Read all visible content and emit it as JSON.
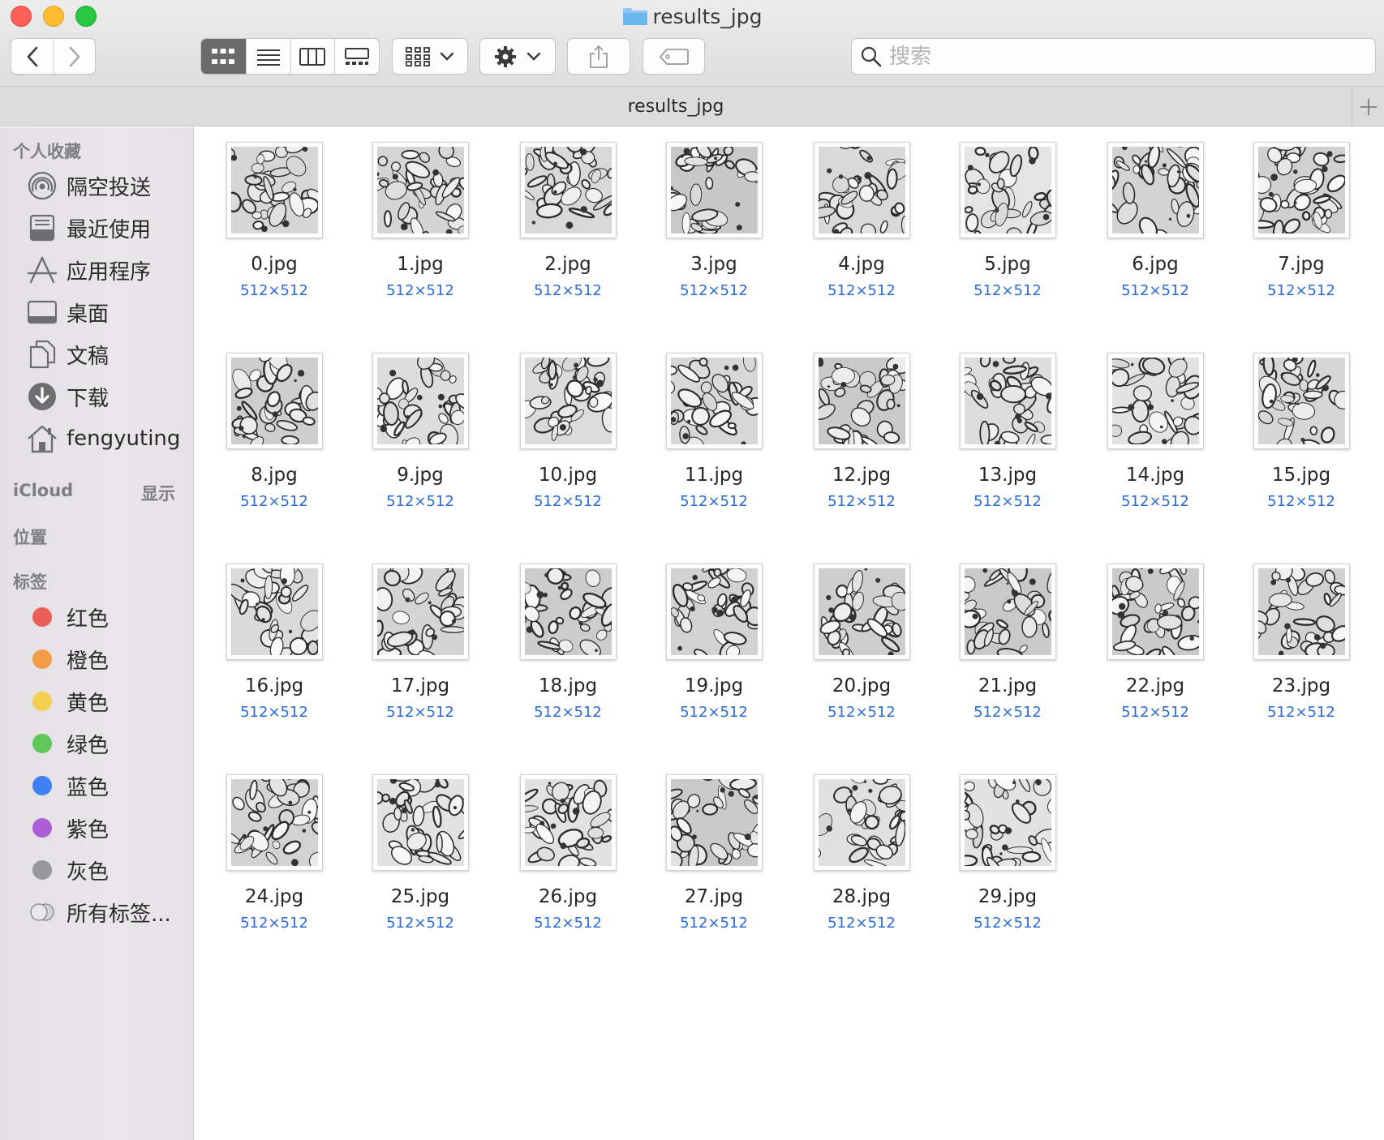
{
  "window": {
    "title": "results_jpg",
    "tab_title": "results_jpg"
  },
  "toolbar": {
    "back": "back",
    "forward": "forward",
    "views": [
      "icon-view",
      "list-view",
      "column-view",
      "gallery-view"
    ],
    "active_view": "icon-view",
    "search_placeholder": "搜索"
  },
  "sidebar": {
    "favorites_heading": "个人收藏",
    "favorites": [
      {
        "label": "隔空投送",
        "icon": "airdrop-icon"
      },
      {
        "label": "最近使用",
        "icon": "recents-icon"
      },
      {
        "label": "应用程序",
        "icon": "applications-icon"
      },
      {
        "label": "桌面",
        "icon": "desktop-icon"
      },
      {
        "label": "文稿",
        "icon": "documents-icon"
      },
      {
        "label": "下载",
        "icon": "downloads-icon"
      },
      {
        "label": "fengyuting",
        "icon": "home-icon"
      }
    ],
    "icloud_heading": "iCloud",
    "icloud_show": "显示",
    "locations_heading": "位置",
    "tags_heading": "标签",
    "tags": [
      {
        "label": "红色",
        "color": "#ec5f59"
      },
      {
        "label": "橙色",
        "color": "#f29c47"
      },
      {
        "label": "黄色",
        "color": "#f5cd4f"
      },
      {
        "label": "绿色",
        "color": "#60c759"
      },
      {
        "label": "蓝色",
        "color": "#3f80f6"
      },
      {
        "label": "紫色",
        "color": "#ac5ed6"
      },
      {
        "label": "灰色",
        "color": "#98979b"
      },
      {
        "label": "所有标签...",
        "color": "all-tags"
      }
    ]
  },
  "files": [
    {
      "name": "0.jpg",
      "dims": "512×512"
    },
    {
      "name": "1.jpg",
      "dims": "512×512"
    },
    {
      "name": "2.jpg",
      "dims": "512×512"
    },
    {
      "name": "3.jpg",
      "dims": "512×512"
    },
    {
      "name": "4.jpg",
      "dims": "512×512"
    },
    {
      "name": "5.jpg",
      "dims": "512×512"
    },
    {
      "name": "6.jpg",
      "dims": "512×512"
    },
    {
      "name": "7.jpg",
      "dims": "512×512"
    },
    {
      "name": "8.jpg",
      "dims": "512×512"
    },
    {
      "name": "9.jpg",
      "dims": "512×512"
    },
    {
      "name": "10.jpg",
      "dims": "512×512"
    },
    {
      "name": "11.jpg",
      "dims": "512×512"
    },
    {
      "name": "12.jpg",
      "dims": "512×512"
    },
    {
      "name": "13.jpg",
      "dims": "512×512"
    },
    {
      "name": "14.jpg",
      "dims": "512×512"
    },
    {
      "name": "15.jpg",
      "dims": "512×512"
    },
    {
      "name": "16.jpg",
      "dims": "512×512"
    },
    {
      "name": "17.jpg",
      "dims": "512×512"
    },
    {
      "name": "18.jpg",
      "dims": "512×512"
    },
    {
      "name": "19.jpg",
      "dims": "512×512"
    },
    {
      "name": "20.jpg",
      "dims": "512×512"
    },
    {
      "name": "21.jpg",
      "dims": "512×512"
    },
    {
      "name": "22.jpg",
      "dims": "512×512"
    },
    {
      "name": "23.jpg",
      "dims": "512×512"
    },
    {
      "name": "24.jpg",
      "dims": "512×512"
    },
    {
      "name": "25.jpg",
      "dims": "512×512"
    },
    {
      "name": "26.jpg",
      "dims": "512×512"
    },
    {
      "name": "27.jpg",
      "dims": "512×512"
    },
    {
      "name": "28.jpg",
      "dims": "512×512"
    },
    {
      "name": "29.jpg",
      "dims": "512×512"
    }
  ]
}
